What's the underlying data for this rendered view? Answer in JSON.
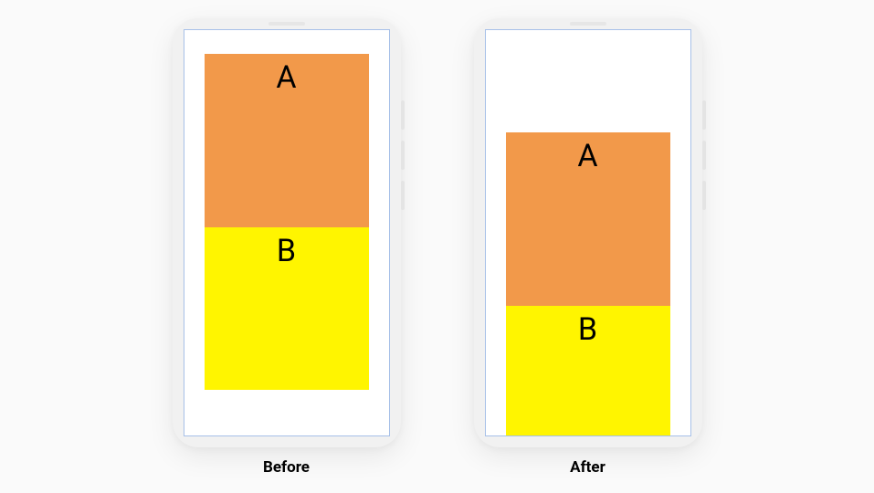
{
  "diagram": {
    "before": {
      "caption": "Before",
      "boxA": {
        "label": "A",
        "color": "#f2994a"
      },
      "boxB": {
        "label": "B",
        "color": "#fff500"
      },
      "layout": "both-visible-top-aligned"
    },
    "after": {
      "caption": "After",
      "boxA": {
        "label": "A",
        "color": "#f2994a"
      },
      "boxB": {
        "label": "B",
        "color": "#fff500"
      },
      "layout": "shifted-down-b-clipped"
    }
  }
}
